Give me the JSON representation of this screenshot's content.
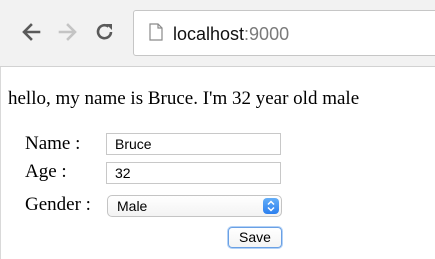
{
  "browser": {
    "url_host": "localhost",
    "url_port": ":9000",
    "icons": {
      "back": "back-arrow-icon",
      "forward": "forward-arrow-icon",
      "reload": "reload-icon",
      "page": "page-icon"
    }
  },
  "page": {
    "greeting": "hello, my name is Bruce. I'm 32 year old male",
    "form": {
      "name_label": "Name :",
      "name_value": "Bruce",
      "age_label": "Age :",
      "age_value": "32",
      "gender_label": "Gender :",
      "gender_value": "Male",
      "save_label": "Save"
    }
  },
  "colors": {
    "toolbar_bg": "#f2f2f2",
    "select_accent": "#3d8ff2",
    "save_focus_ring": "#6aa0e4"
  }
}
